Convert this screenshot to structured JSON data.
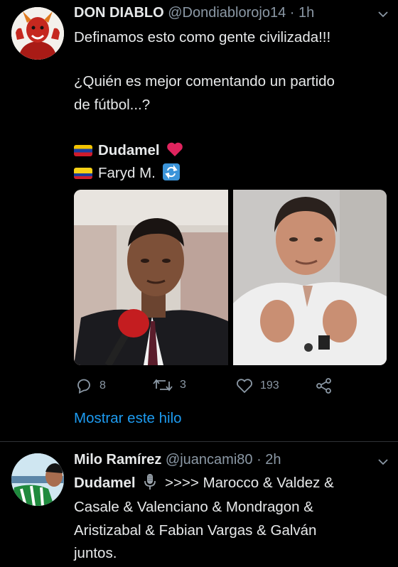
{
  "tweet1": {
    "display_name": "DON DIABLO",
    "handle": "@Dondiablorojo14",
    "separator": " · ",
    "time": "1h",
    "line1": "Definamos esto como gente civilizada!!!",
    "line2": "¿Quién es mejor comentando un partido",
    "line3": "de fútbol...?",
    "option1": "Dudamel",
    "option2": "Faryd M.",
    "actions": {
      "replies": "8",
      "retweets": "3",
      "likes": "193"
    },
    "show_thread": "Mostrar este hilo"
  },
  "tweet2": {
    "display_name": "Milo Ramírez",
    "handle": "@juancami80",
    "separator": " · ",
    "time": "2h",
    "line1_bold": "Dudamel",
    "line1_rest": ">>>> Marocco & Valdez &",
    "line2": "Casale & Valenciano & Mondragon &",
    "line3": "Aristizabal & Fabian Vargas & Galván",
    "line4": "juntos."
  },
  "colors": {
    "background": "#000000",
    "accent": "#1d9bf0",
    "heart": "#e0245e"
  }
}
